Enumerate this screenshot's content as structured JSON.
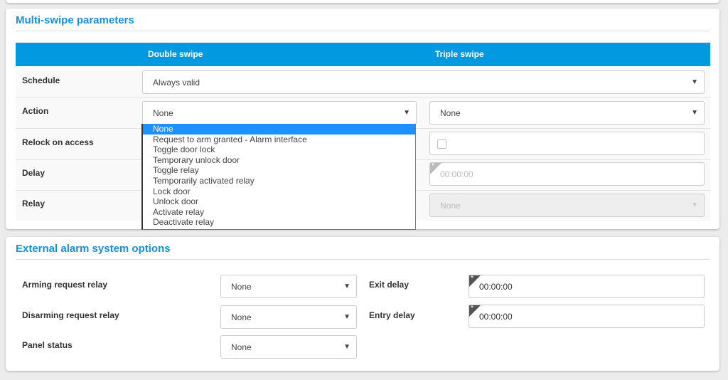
{
  "multi_swipe": {
    "title": "Multi-swipe parameters",
    "columns": [
      "Double swipe",
      "Triple swipe"
    ],
    "rows": {
      "schedule": "Schedule",
      "action": "Action",
      "relock": "Relock on access",
      "delay": "Delay",
      "relay": "Relay"
    },
    "schedule_value": "Always valid",
    "action_double": "None",
    "action_triple": "None",
    "delay_triple": "00:00:00",
    "relay_triple": "None",
    "action_options": [
      "None",
      "Request to arm granted - Alarm interface",
      "Toggle door lock",
      "Temporary unlock door",
      "Toggle relay",
      "Temporarily activated relay",
      "Lock door",
      "Unlock door",
      "Activate relay",
      "Deactivate relay"
    ],
    "action_selected": "None"
  },
  "alarm": {
    "title": "External alarm system options",
    "arming_label": "Arming request relay",
    "arming_value": "None",
    "disarming_label": "Disarming request relay",
    "disarming_value": "None",
    "panel_label": "Panel status",
    "panel_value": "None",
    "exit_label": "Exit delay",
    "exit_value": "00:00:00",
    "entry_label": "Entry delay",
    "entry_value": "00:00:00"
  },
  "colors": {
    "accent": "#0299e0",
    "title": "#1a8fd6",
    "highlight": "#1e90ff"
  }
}
